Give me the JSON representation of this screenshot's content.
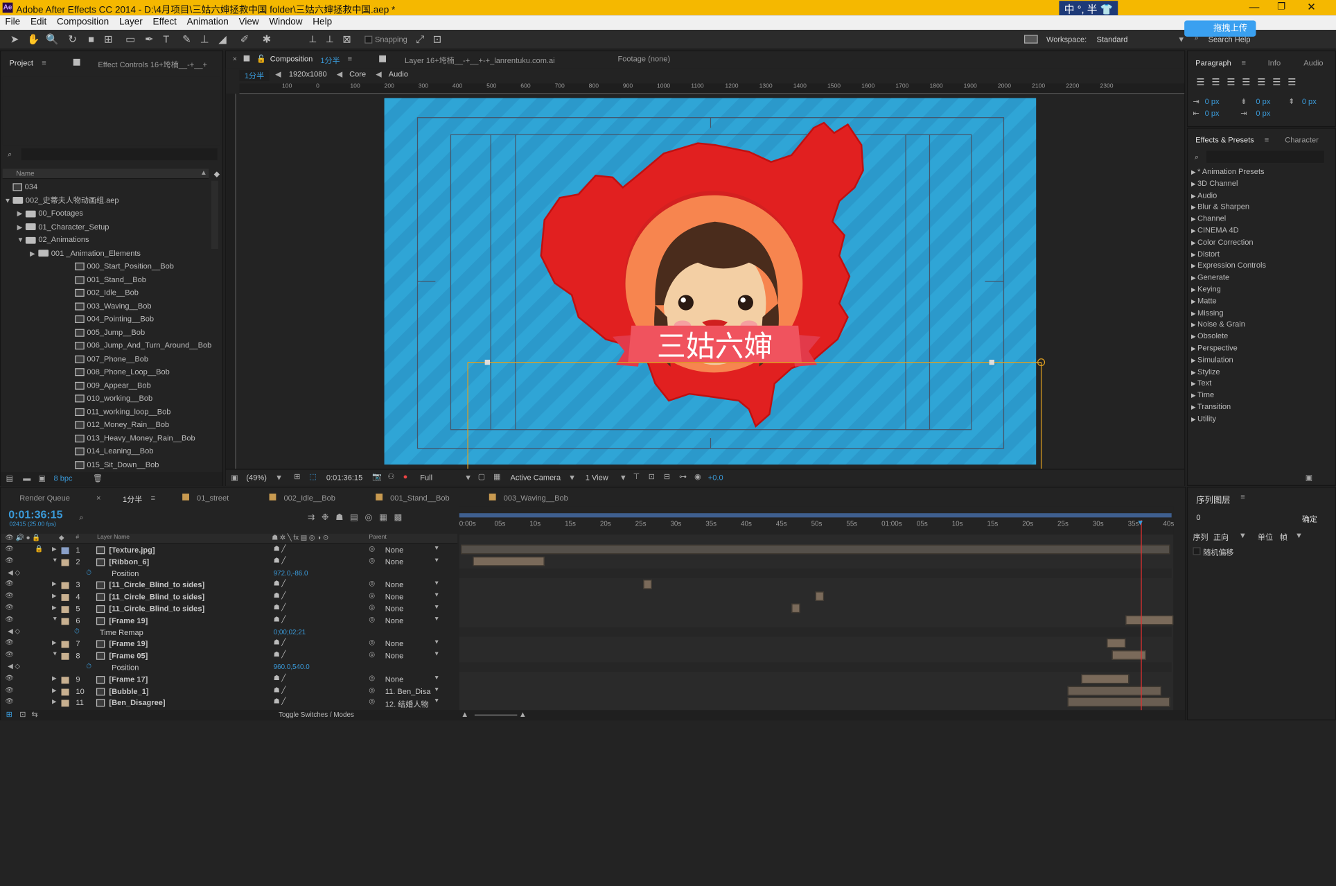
{
  "title_bar": {
    "text": "Adobe After Effects CC 2014 - D:\\4月项目\\三姑六婶拯救中国 folder\\三姑六婶拯救中国.aep *",
    "ime": "中 °, 半 👕",
    "badge": "拖拽上传"
  },
  "menu": [
    "File",
    "Edit",
    "Composition",
    "Layer",
    "Effect",
    "Animation",
    "View",
    "Window",
    "Help"
  ],
  "toolbar": {
    "snapping": "Snapping",
    "workspace_label": "Workspace:",
    "workspace_value": "Standard",
    "search": "Search Help"
  },
  "project": {
    "tab_project": "Project",
    "tab_effect_controls": "Effect Controls 16+垮楠__-+__+",
    "col_name": "Name",
    "bpc": "8 bpc",
    "items": [
      {
        "name": "034",
        "type": "comp",
        "indent": 0,
        "tri": ""
      },
      {
        "name": "002_史蒂夫人物动画组.aep",
        "type": "folder",
        "indent": 0,
        "tri": "▼"
      },
      {
        "name": "00_Footages",
        "type": "folder",
        "indent": 1,
        "tri": "▶"
      },
      {
        "name": "01_Character_Setup",
        "type": "folder",
        "indent": 1,
        "tri": "▶"
      },
      {
        "name": "02_Animations",
        "type": "folder",
        "indent": 1,
        "tri": "▼"
      },
      {
        "name": "001 _Animation_Elements",
        "type": "folder",
        "indent": 2,
        "tri": "▶"
      },
      {
        "name": "000_Start_Position__Bob",
        "type": "comp",
        "indent": 3,
        "tri": ""
      },
      {
        "name": "001_Stand__Bob",
        "type": "comp",
        "indent": 3,
        "tri": ""
      },
      {
        "name": "002_Idle__Bob",
        "type": "comp",
        "indent": 3,
        "tri": ""
      },
      {
        "name": "003_Waving__Bob",
        "type": "comp",
        "indent": 3,
        "tri": ""
      },
      {
        "name": "004_Pointing__Bob",
        "type": "comp",
        "indent": 3,
        "tri": ""
      },
      {
        "name": "005_Jump__Bob",
        "type": "comp",
        "indent": 3,
        "tri": ""
      },
      {
        "name": "006_Jump_And_Turn_Around__Bob",
        "type": "comp",
        "indent": 3,
        "tri": ""
      },
      {
        "name": "007_Phone__Bob",
        "type": "comp",
        "indent": 3,
        "tri": ""
      },
      {
        "name": "008_Phone_Loop__Bob",
        "type": "comp",
        "indent": 3,
        "tri": ""
      },
      {
        "name": "009_Appear__Bob",
        "type": "comp",
        "indent": 3,
        "tri": ""
      },
      {
        "name": "010_working__Bob",
        "type": "comp",
        "indent": 3,
        "tri": ""
      },
      {
        "name": "011_working_loop__Bob",
        "type": "comp",
        "indent": 3,
        "tri": ""
      },
      {
        "name": "012_Money_Rain__Bob",
        "type": "comp",
        "indent": 3,
        "tri": ""
      },
      {
        "name": "013_Heavy_Money_Rain__Bob",
        "type": "comp",
        "indent": 3,
        "tri": ""
      },
      {
        "name": "014_Leaning__Bob",
        "type": "comp",
        "indent": 3,
        "tri": ""
      },
      {
        "name": "015_Sit_Down__Bob",
        "type": "comp",
        "indent": 3,
        "tri": ""
      }
    ]
  },
  "comp_panel": {
    "tab_comp": "Composition",
    "tab_comp_name": "1分半",
    "tab_layer": "Layer 16+垮楠__-+__+-+_lanrentuku.com.ai",
    "tab_footage": "Footage (none)",
    "sub_name": "1分半",
    "sub_res": "1920x1080",
    "sub_core": "Core",
    "sub_audio": "Audio",
    "ruler": [
      "100",
      "0",
      "100",
      "200",
      "300",
      "400",
      "500",
      "600",
      "700",
      "800",
      "900",
      "1000",
      "1100",
      "1200",
      "1300",
      "1400",
      "1500",
      "1600",
      "1700",
      "1800",
      "1900",
      "2000",
      "2100",
      "2200",
      "2300"
    ],
    "zoom": "(49%)",
    "time": "0:01:36:15",
    "resolution": "Full",
    "camera": "Active Camera",
    "view": "1 View",
    "exposure": "+0.0",
    "banner_text": "三姑六婶"
  },
  "right_panel": {
    "tab_paragraph": "Paragraph",
    "tab_info": "Info",
    "tab_audio": "Audio",
    "px_values": [
      "0 px",
      "0 px",
      "0 px",
      "0 px",
      "0 px"
    ],
    "tab_effects": "Effects & Presets",
    "tab_character": "Character",
    "effects": [
      "* Animation Presets",
      "3D Channel",
      "Audio",
      "Blur & Sharpen",
      "Channel",
      "CINEMA 4D",
      "Color Correction",
      "Distort",
      "Expression Controls",
      "Generate",
      "Keying",
      "Matte",
      "Missing",
      "Noise & Grain",
      "Obsolete",
      "Perspective",
      "Simulation",
      "Stylize",
      "Text",
      "Time",
      "Transition",
      "Utility"
    ],
    "seq_title": "序列图层",
    "seq_value": "0",
    "seq_ok": "确定",
    "seq_order": "序列",
    "seq_dir": "正向",
    "seq_unit": "单位",
    "seq_frame": "帧",
    "seq_random": "随机偏移"
  },
  "timeline": {
    "tab_render": "Render Queue",
    "tab_main": "1分半",
    "tab_street": "01_street",
    "tab_idle": "002_Idle__Bob",
    "tab_stand": "001_Stand__Bob",
    "tab_wave": "003_Waving__Bob",
    "timecode": "0:01:36:15",
    "fps": "02415 (25.00 fps)",
    "col_layer": "Layer Name",
    "col_parent": "Parent",
    "toggle": "Toggle Switches / Modes",
    "ticks": [
      "0:00s",
      "05s",
      "10s",
      "15s",
      "20s",
      "25s",
      "30s",
      "35s",
      "40s",
      "45s",
      "50s",
      "55s",
      "01:00s",
      "05s",
      "10s",
      "15s",
      "20s",
      "25s",
      "30s",
      "35s",
      "40s"
    ],
    "layers": [
      {
        "num": "1",
        "name": "[Texture.jpg]",
        "parent": "None",
        "kind": "layer"
      },
      {
        "num": "2",
        "name": "[Ribbon_6]",
        "parent": "None",
        "kind": "layer"
      },
      {
        "num": "",
        "name": "Position",
        "parent": "",
        "kind": "prop",
        "value": "972.0,-86.0"
      },
      {
        "num": "3",
        "name": "[11_Circle_Blind_to sides]",
        "parent": "None",
        "kind": "layer"
      },
      {
        "num": "4",
        "name": "[11_Circle_Blind_to sides]",
        "parent": "None",
        "kind": "layer"
      },
      {
        "num": "5",
        "name": "[11_Circle_Blind_to sides]",
        "parent": "None",
        "kind": "layer"
      },
      {
        "num": "6",
        "name": "[Frame 19]",
        "parent": "None",
        "kind": "layer"
      },
      {
        "num": "",
        "name": "Time Remap",
        "parent": "",
        "kind": "prop",
        "value": "0;00;02;21"
      },
      {
        "num": "7",
        "name": "[Frame 19]",
        "parent": "None",
        "kind": "layer"
      },
      {
        "num": "8",
        "name": "[Frame 05]",
        "parent": "None",
        "kind": "layer"
      },
      {
        "num": "",
        "name": "Position",
        "parent": "",
        "kind": "prop",
        "value": "960.0,540.0"
      },
      {
        "num": "9",
        "name": "[Frame 17]",
        "parent": "None",
        "kind": "layer"
      },
      {
        "num": "10",
        "name": "[Bubble_1]",
        "parent": "11. Ben_Disa",
        "kind": "layer"
      },
      {
        "num": "11",
        "name": "[Ben_Disagree]",
        "parent": "12. 结婚人物",
        "kind": "layer"
      }
    ]
  }
}
